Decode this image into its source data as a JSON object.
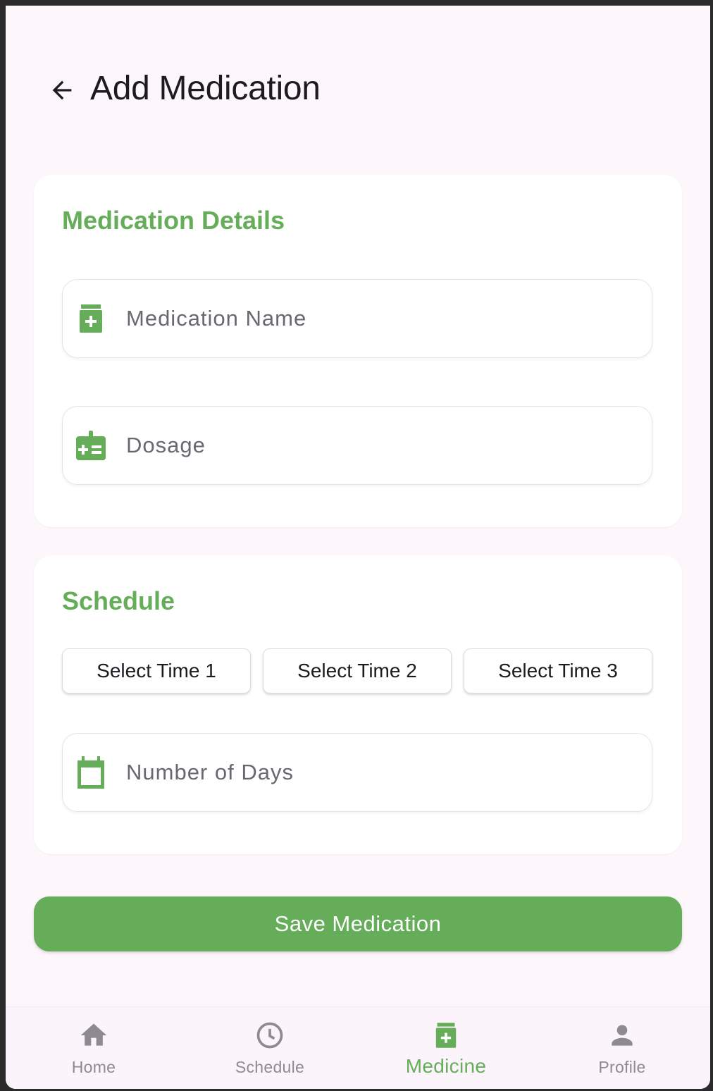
{
  "header": {
    "title": "Add Medication"
  },
  "details": {
    "title": "Medication Details",
    "name_placeholder": "Medication Name",
    "dosage_placeholder": "Dosage"
  },
  "schedule": {
    "title": "Schedule",
    "time_buttons": [
      "Select Time 1",
      "Select Time 2",
      "Select Time 3"
    ],
    "days_placeholder": "Number of Days"
  },
  "save_label": "Save Medication",
  "nav": {
    "items": [
      {
        "label": "Home",
        "icon": "home-icon"
      },
      {
        "label": "Schedule",
        "icon": "clock-icon"
      },
      {
        "label": "Medicine",
        "icon": "medication-icon"
      },
      {
        "label": "Profile",
        "icon": "person-icon"
      }
    ],
    "active": "Medicine"
  },
  "colors": {
    "accent": "#66ad5a",
    "background": "#fdf7fc",
    "inactive": "#8e8a91"
  }
}
